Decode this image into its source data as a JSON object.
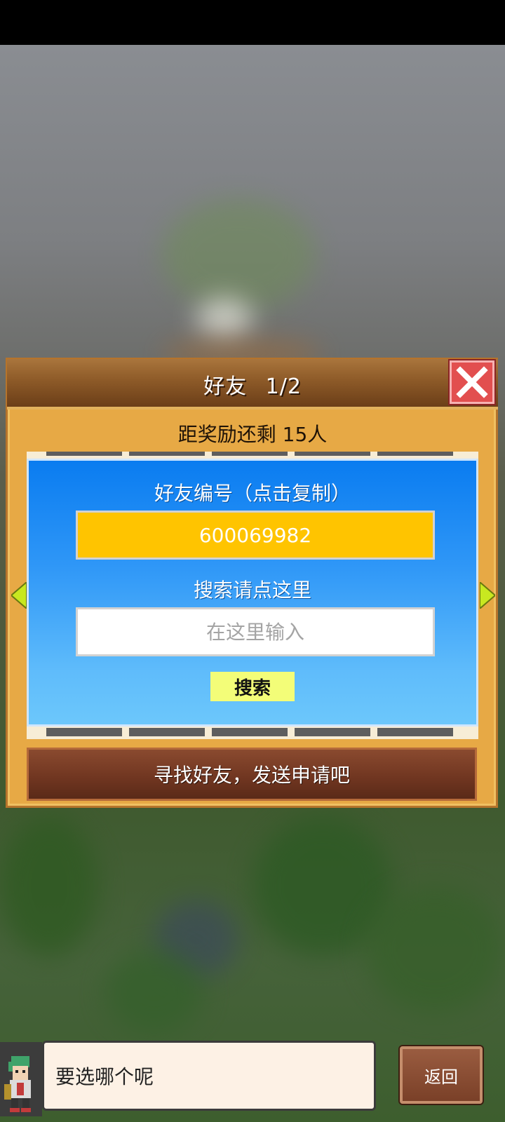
{
  "title": {
    "label": "好友",
    "page": "1/2"
  },
  "reward": {
    "text": "距奖励还剩 15人"
  },
  "friend_id": {
    "label": "好友编号（点击复制）",
    "value": "600069982"
  },
  "search": {
    "label": "搜索请点这里",
    "placeholder": "在这里输入",
    "button": "搜索"
  },
  "cta": {
    "text": "寻找好友，发送申请吧"
  },
  "dialog": {
    "text": "要选哪个呢"
  },
  "back_button": {
    "label": "返回"
  },
  "icons": {
    "close": "close-icon",
    "prev": "arrow-left-icon",
    "next": "arrow-right-icon",
    "avatar": "character-avatar-icon"
  },
  "colors": {
    "panel": "#e7a945",
    "title_bar": "#8d5a28",
    "close": "#e24f4f",
    "card_top": "#0a7cf0",
    "card_bottom": "#6cc7fb",
    "id_box": "#ffc400",
    "search_button": "#f3fd78",
    "cta": "#6f3520"
  }
}
